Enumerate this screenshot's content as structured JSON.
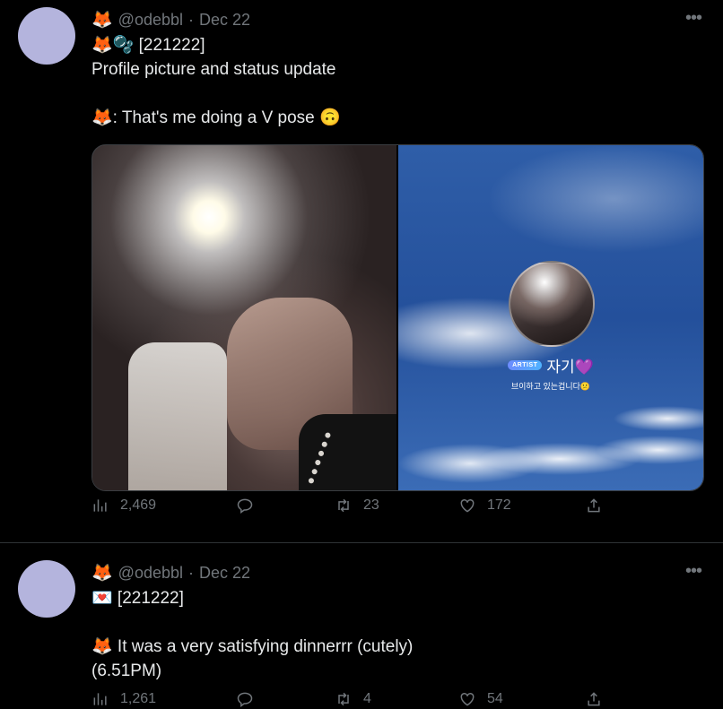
{
  "tweets": [
    {
      "handle": "@odebbl",
      "sep": "·",
      "date": "Dec 22",
      "header_emoji": "🦊",
      "title_line": "🦊🫧 [221222]",
      "line2": "Profile picture and status update",
      "line3": "🦊: That's me doing a V pose 🙃",
      "media": {
        "artist_badge": "ARTIST",
        "artist_name": "자기💜",
        "status_message": "브이하고 있는겁니다😕"
      },
      "stats": {
        "views": "2,469",
        "replies": "",
        "retweets": "23",
        "likes": "172"
      }
    },
    {
      "handle": "@odebbl",
      "sep": "·",
      "date": "Dec 22",
      "header_emoji": "🦊",
      "title_line": "💌 [221222]",
      "line2": "",
      "line3": "🦊 It was a very satisfying dinnerrr (cutely)",
      "line4": "(6.51PM)",
      "stats": {
        "views": "1,261",
        "replies": "",
        "retweets": "4",
        "likes": "54"
      }
    }
  ],
  "icons": [
    "more-icon",
    "views-icon",
    "reply-icon",
    "retweet-icon",
    "like-icon",
    "share-icon"
  ]
}
